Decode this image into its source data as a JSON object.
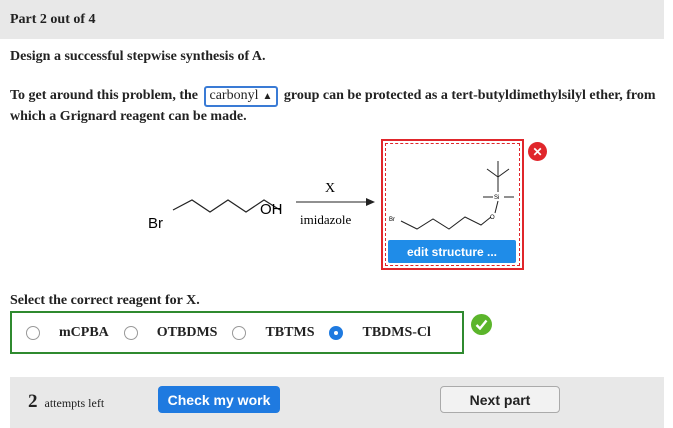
{
  "header": {
    "part_label": "Part 2 out of 4"
  },
  "question": {
    "line1": "Design a successful stepwise synthesis of A.",
    "line2_before": "To get around this problem, the",
    "group_select_value": "carbonyl",
    "line2_after": "group can be protected as a tert-butyldimethylsilyl ether, from which a Grignard reagent can be made."
  },
  "reaction": {
    "reactant_br": "Br",
    "reactant_oh": "OH",
    "arrow_top": "X",
    "arrow_bottom": "imidazole"
  },
  "answer": {
    "product_br": "Br",
    "product_si": "Si",
    "product_o": "O",
    "edit_button": "edit structure ..."
  },
  "reagent": {
    "prompt": "Select the correct reagent for X.",
    "options": [
      "mCPBA",
      "OTBDMS",
      "TBTMS",
      "TBDMS-Cl"
    ],
    "selected": "TBDMS-Cl"
  },
  "footer": {
    "attempts_count": "2",
    "attempts_label": "attempts left",
    "check_button": "Check my work",
    "next_button": "Next part"
  },
  "colors": {
    "accent": "#1f7ae0",
    "error": "#e0262b",
    "correct": "#2f8a2f"
  }
}
